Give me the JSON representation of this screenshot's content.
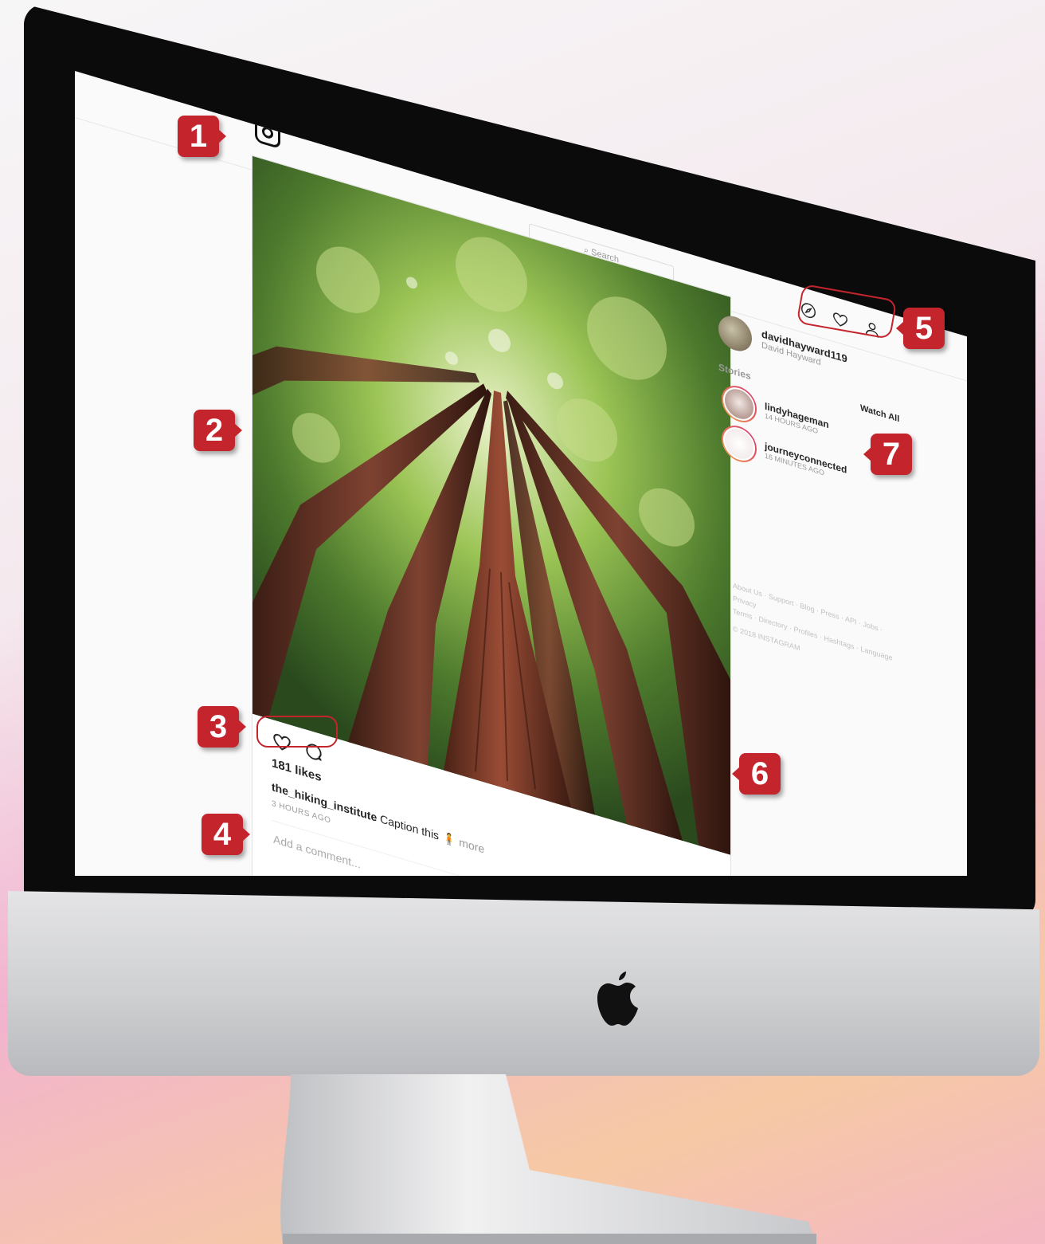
{
  "header": {
    "search_placeholder": "Search"
  },
  "profile": {
    "username": "davidhayward119",
    "name": "David Hayward"
  },
  "stories": {
    "label": "Stories",
    "watch_all": "Watch All",
    "items": [
      {
        "username": "lindyhageman",
        "time": "14 HOURS AGO"
      },
      {
        "username": "journeyconnected",
        "time": "16 MINUTES AGO"
      }
    ]
  },
  "post": {
    "likes": "181 likes",
    "username": "the_hiking_institute",
    "caption": "Caption this 🧍",
    "more": "more",
    "time": "3 HOURS AGO",
    "comment_placeholder": "Add a comment...",
    "options": "..."
  },
  "footer": {
    "links_line1": "About Us · Support · Blog · Press · API · Jobs · Privacy",
    "links_line2": "Terms · Directory · Profiles · Hashtags · Language",
    "copyright": "© 2018 INSTAGRAM"
  },
  "callouts": [
    "1",
    "2",
    "3",
    "4",
    "5",
    "6",
    "7"
  ],
  "colors": {
    "callout": "#c4252d",
    "story_ring_start": "#f3a250",
    "story_ring_end": "#d6336c"
  },
  "icons": [
    "instagram-logo-icon",
    "search-icon",
    "compass-icon",
    "heart-icon",
    "profile-icon",
    "comment-icon",
    "bookmark-icon",
    "apple-logo-icon"
  ]
}
